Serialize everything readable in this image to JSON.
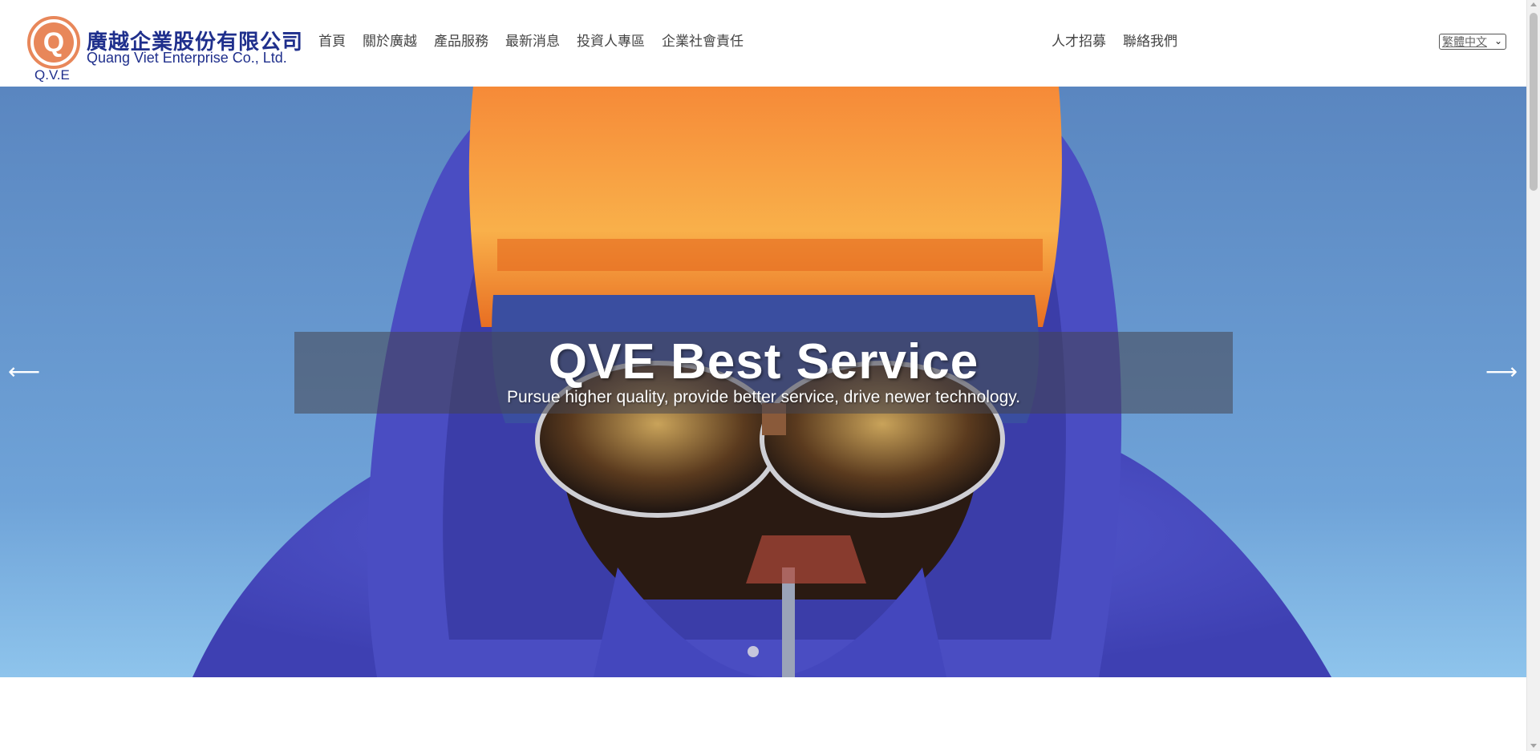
{
  "header": {
    "logo": {
      "name_zh": "廣越企業股份有限公司",
      "name_en": "Quang Viet Enterprise Co., Ltd.",
      "abbr": "Q.V.E",
      "mark_letter": "Q",
      "brand_color": "#1f2f8c",
      "accent_color": "#e8875a"
    },
    "nav_main": [
      {
        "label": "首頁"
      },
      {
        "label": "關於廣越"
      },
      {
        "label": "產品服務"
      },
      {
        "label": "最新消息"
      },
      {
        "label": "投資人專區"
      },
      {
        "label": "企業社會責任"
      }
    ],
    "nav_right": [
      {
        "label": "人才招募"
      },
      {
        "label": "聯絡我們"
      }
    ],
    "language": {
      "selected": "繁體中文",
      "icon": "chevron-down-icon"
    }
  },
  "hero": {
    "title": "QVE Best Service",
    "subtitle": "Pursue higher quality, provide better service, drive newer technology.",
    "prev_icon": "arrow-left-icon",
    "next_icon": "arrow-right-icon",
    "slides_total": 1,
    "active_slide": 1,
    "sky_color": "#5f8fc9",
    "jacket_color": "#4c4fc4",
    "hat_color": "#f47b2a"
  }
}
